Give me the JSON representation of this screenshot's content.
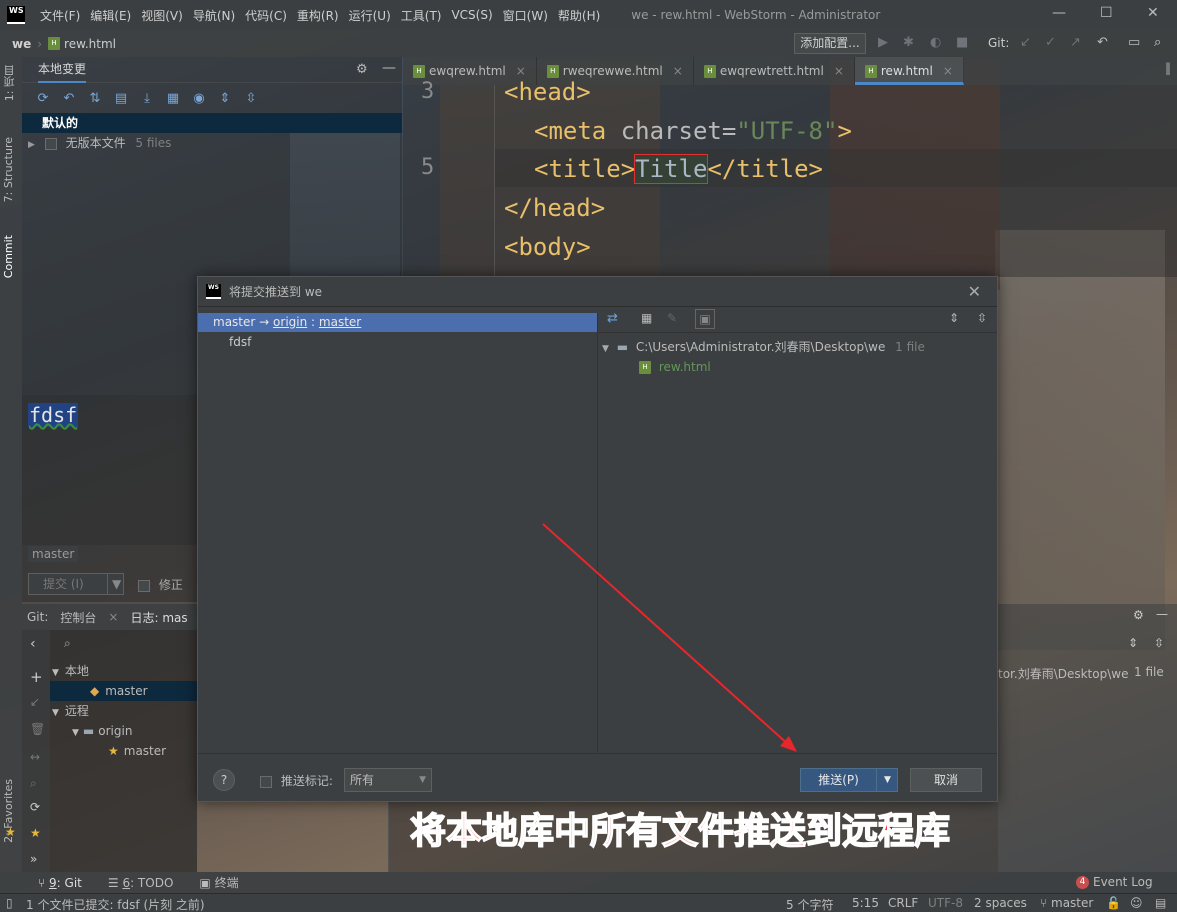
{
  "window": {
    "title": "we - rew.html - WebStorm - Administrator",
    "logo": "WS",
    "menu": [
      "文件(F)",
      "编辑(E)",
      "视图(V)",
      "导航(N)",
      "代码(C)",
      "重构(R)",
      "运行(U)",
      "工具(T)",
      "VCS(S)",
      "窗口(W)",
      "帮助(H)"
    ]
  },
  "navbar": {
    "project": "we",
    "file": "rew.html",
    "config_button": "添加配置...",
    "git_label": "Git:"
  },
  "left_stripe": {
    "project_tab": "1: 项目",
    "structure_tab": "7: Structure",
    "commit_tab": "Commit",
    "favorites_tab": "2: Favorites"
  },
  "local_changes": {
    "tab": "本地变更",
    "changelist": "默认的",
    "unversioned": "无版本文件",
    "unversioned_count": "5 files",
    "commit_message": "fdsf",
    "branch": "master",
    "commit_button": "提交 (I)",
    "amend_label": "修正"
  },
  "git_panel": {
    "label": "Git:",
    "console_tab": "控制台",
    "log_tab": "日志: mas",
    "local": "本地",
    "local_branch": "master",
    "remote": "远程",
    "origin": "origin",
    "remote_branch": "master"
  },
  "editor_tabs": [
    {
      "name": "ewqrew.html",
      "active": false
    },
    {
      "name": "rweqrewwe.html",
      "active": false
    },
    {
      "name": "ewqrewtrett.html",
      "active": false
    },
    {
      "name": "rew.html",
      "active": true
    }
  ],
  "editor": {
    "line_3": "3",
    "line_5": "5",
    "head_open": "<head>",
    "meta_open": "<meta ",
    "meta_attr": "charset=",
    "meta_value": "\"UTF-8\"",
    "meta_close": ">",
    "title_open": "<title>",
    "title_text": "Title",
    "title_close": "</title>",
    "head_close": "</head>",
    "body_open": "<body>"
  },
  "dialog": {
    "title": "将提交推送到 we",
    "push_local": "master",
    "push_arrow": "→",
    "push_remote": "origin",
    "push_sep": ":",
    "push_remote_branch": "master",
    "commit": "fdsf",
    "path": "C:\\Users\\Administrator.刘春雨\\Desktop\\we",
    "file_count": "1 file",
    "file": "rew.html",
    "push_tags_label": "推送标记:",
    "tags_option": "所有",
    "push_button": "推送(P)",
    "cancel_button": "取消",
    "help": "?"
  },
  "background_panel": {
    "path_fragment": "tor.刘春雨\\Desktop\\we",
    "file_count": "1 file"
  },
  "annotation": "将本地库中所有文件推送到远程库",
  "bottom_tabs": [
    {
      "num": "9",
      "label": ": Git"
    },
    {
      "num": "6",
      "label": ": TODO"
    },
    {
      "num": "",
      "label": "终端"
    }
  ],
  "event_log": {
    "count": "4",
    "label": "Event Log"
  },
  "status": {
    "message": "1 个文件已提交: fdsf (片刻 之前)",
    "chars": "5 个字符",
    "position": "5:15",
    "line_sep": "CRLF",
    "encoding": "UTF-8",
    "indent": "2 spaces",
    "branch": "master"
  },
  "colors": {
    "accent": "#4a88c7",
    "selection": "#4b6eaf",
    "annotation": "#ff3030",
    "arrow": "#e8262b"
  }
}
